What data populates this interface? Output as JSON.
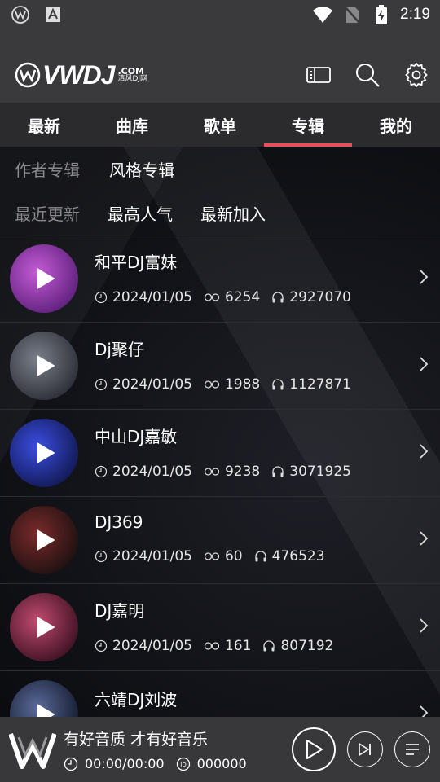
{
  "status": {
    "time": "2:19"
  },
  "brand": {
    "logo_text": "VWDJ",
    "logo_com": ".COM",
    "logo_sub": "清风DJ网"
  },
  "main_tabs": [
    {
      "label": "最新"
    },
    {
      "label": "曲库"
    },
    {
      "label": "歌单"
    },
    {
      "label": "专辑",
      "active": true
    },
    {
      "label": "我的"
    }
  ],
  "album_type_tabs": [
    {
      "label": "作者专辑",
      "selected": true
    },
    {
      "label": "风格专辑"
    }
  ],
  "sort_tabs": [
    {
      "label": "最近更新",
      "selected": true
    },
    {
      "label": "最高人气"
    },
    {
      "label": "最新加入"
    }
  ],
  "albums": [
    {
      "title": "和平DJ富妹",
      "date": "2024/01/05",
      "count": "6254",
      "plays": "2927070",
      "cover_colors": [
        "#c55bd6",
        "#5b1f7a"
      ]
    },
    {
      "title": "Dj聚仔",
      "date": "2024/01/05",
      "count": "1988",
      "plays": "1127871",
      "cover_colors": [
        "#7a7f8a",
        "#2a2c34"
      ]
    },
    {
      "title": "中山DJ嘉敏",
      "date": "2024/01/05",
      "count": "9238",
      "plays": "3071925",
      "cover_colors": [
        "#3b4de0",
        "#101850"
      ]
    },
    {
      "title": "DJ369",
      "date": "2024/01/05",
      "count": "60",
      "plays": "476523",
      "cover_colors": [
        "#7a2a2a",
        "#1a1010"
      ]
    },
    {
      "title": "DJ嘉明",
      "date": "2024/01/05",
      "count": "161",
      "plays": "807192",
      "cover_colors": [
        "#c04a70",
        "#3a1020"
      ]
    },
    {
      "title": "六靖DJ刘波",
      "date": "",
      "count": "",
      "plays": "",
      "cover_colors": [
        "#5a6a9a",
        "#12182a"
      ]
    }
  ],
  "player": {
    "title": "有好音质 才有好音乐",
    "time": "00:00/00:00",
    "id": "000000"
  },
  "colors": {
    "accent": "#e8505b",
    "topbar": "#3a3a3c",
    "tabbar": "#2b2b2d"
  }
}
